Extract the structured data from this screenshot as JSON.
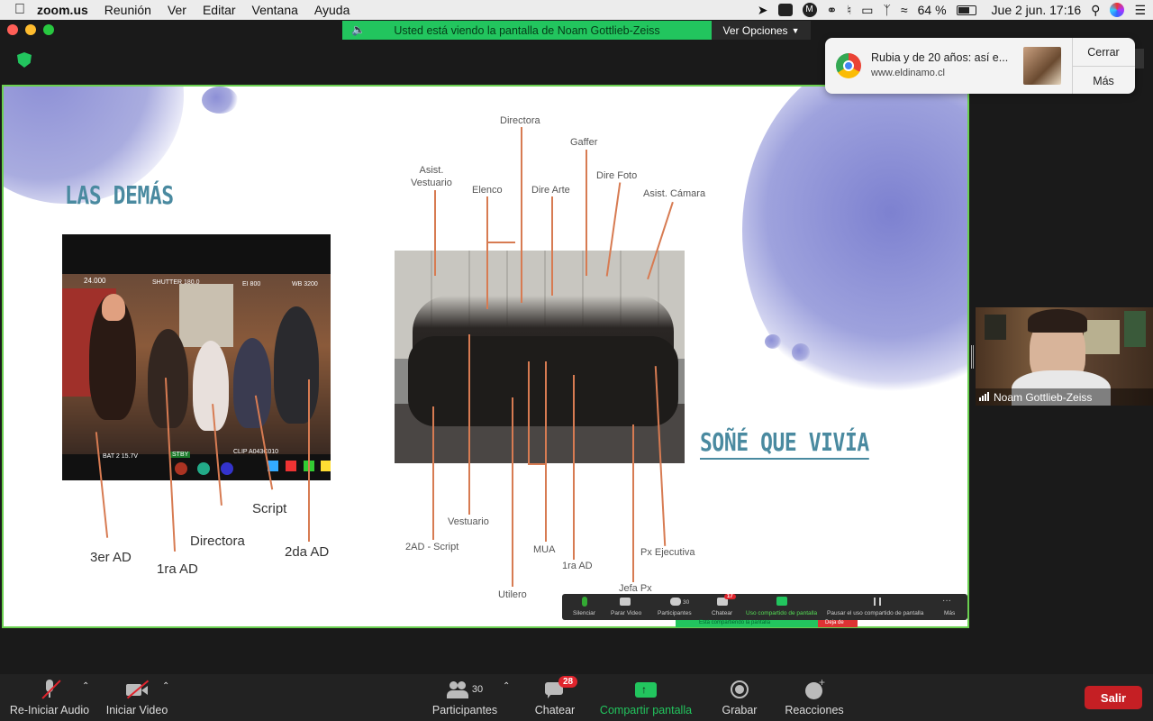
{
  "menubar": {
    "apple": "",
    "app": "zoom.us",
    "items": [
      "Reunión",
      "Ver",
      "Editar",
      "Ventana",
      "Ayuda"
    ],
    "battery": "64 %",
    "datetime": "Jue 2 jun.  17:16"
  },
  "share_banner": {
    "text": "Usted está viendo la pantalla de Noam Gottlieb-Zeiss",
    "options": "Ver Opciones"
  },
  "notification": {
    "title": "Rubia y de 20 años: así e...",
    "url": "www.eldinamo.cl",
    "close": "Cerrar",
    "more": "Más"
  },
  "slide": {
    "title_left": "LAS DEMÁS",
    "title_right": "SOÑÉ QUE VIVÍA",
    "left_photo_overlay": {
      "fps": "24.000",
      "shutter": "SHUTTER 180.0",
      "ei": "EI 800",
      "wb": "WB 3200",
      "bat": "BAT 2 15.7V",
      "stby": "STBY",
      "clip": "CLIP A043C010"
    },
    "left_labels": [
      "3er AD",
      "1ra AD",
      "Directora",
      "Script",
      "2da AD"
    ],
    "right_top_labels": [
      "Asist.\nVestuario",
      "Elenco",
      "Directora",
      "Dire Arte",
      "Gaffer",
      "Dire Foto",
      "Asist. Cámara"
    ],
    "right_bottom_labels": [
      "2AD - Script",
      "Vestuario",
      "Utilero",
      "MUA",
      "1ra AD",
      "Jefa Px",
      "Px Ejecutiva"
    ]
  },
  "mini_toolbar": {
    "items": [
      "Silenciar",
      "Parar Video",
      "Participantes",
      "Chatear",
      "Uso compartido de pantalla",
      "Pausar el uso compartido de pantalla",
      "Más"
    ],
    "participants": "30",
    "chat_badge": "17",
    "status": "Está compartiendo la pantalla",
    "stop": "Deja de"
  },
  "self_view": {
    "name": "Noam Gottlieb-Zeiss"
  },
  "toolbar": {
    "audio": "Re-Iniciar Audio",
    "video": "Iniciar Video",
    "participants": "Participantes",
    "participants_count": "30",
    "chat": "Chatear",
    "chat_badge": "28",
    "share": "Compartir pantalla",
    "record": "Grabar",
    "reactions": "Reacciones",
    "leave": "Salir"
  },
  "colors": {
    "accent_green": "#22c55e",
    "leave_red": "#c51f24",
    "title_teal": "#4a8aa0",
    "line_orange": "#d77b52"
  }
}
